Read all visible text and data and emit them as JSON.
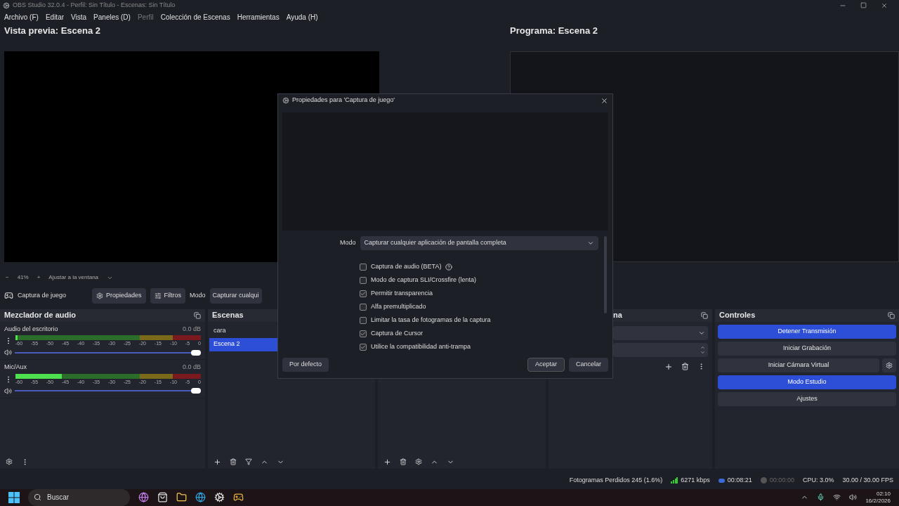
{
  "window": {
    "title": "OBS Studio 32.0.4 - Perfil: Sin Título - Escenas: Sin Título"
  },
  "menu": [
    {
      "label": "Archivo (F)",
      "disabled": false
    },
    {
      "label": "Editar",
      "disabled": false
    },
    {
      "label": "Vista",
      "disabled": false
    },
    {
      "label": "Paneles (D)",
      "disabled": false
    },
    {
      "label": "Perfil",
      "disabled": true
    },
    {
      "label": "Colección de Escenas",
      "disabled": false
    },
    {
      "label": "Herramientas",
      "disabled": false
    },
    {
      "label": "Ayuda (H)",
      "disabled": false
    }
  ],
  "preview": {
    "title": "Vista previa: Escena 2",
    "minus": "−",
    "zoom": "41%",
    "plus": "+",
    "fit": "Ajustar a la ventana"
  },
  "program": {
    "title": "Programa: Escena 2"
  },
  "source_bar": {
    "source": "Captura de juego",
    "properties": "Propiedades",
    "filters": "Filtros",
    "mode_label": "Modo",
    "mode_value": "Capturar cualqui"
  },
  "mixer": {
    "title": "Mezclador de audio",
    "channels": [
      {
        "name": "Audio del escritorio",
        "reading": "0.0 dB",
        "level": 0.01,
        "scale": [
          "-60",
          "-55",
          "-50",
          "-45",
          "-40",
          "-35",
          "-30",
          "-25",
          "-20",
          "-15",
          "-10",
          "-5",
          "0"
        ],
        "volume": {
          "level": 1
        }
      },
      {
        "name": "Mic/Aux",
        "reading": "0.0 dB",
        "level": 0.25,
        "scale": [
          "-60",
          "-55",
          "-50",
          "-45",
          "-40",
          "-35",
          "-30",
          "-25",
          "-20",
          "-15",
          "-10",
          "-5",
          "0"
        ],
        "volume": {
          "level": 1
        }
      }
    ]
  },
  "scenes": {
    "title": "Escenas",
    "items": [
      {
        "name": "cara",
        "selected": false
      },
      {
        "name": "Escena 2",
        "selected": true
      }
    ]
  },
  "transitions": {
    "title": "na"
  },
  "controls": {
    "title": "Controles",
    "buttons": [
      {
        "label": "Detener Transmisión",
        "active": true,
        "kind": "plain"
      },
      {
        "label": "Iniciar Grabación",
        "active": false,
        "kind": "plain"
      },
      {
        "label": "Iniciar Cámara Virtual",
        "active": false,
        "kind": "settings"
      },
      {
        "label": "Modo Estudio",
        "active": true,
        "kind": "plain"
      },
      {
        "label": "Ajustes",
        "active": false,
        "kind": "plain"
      }
    ]
  },
  "dialog": {
    "title": "Propiedades para 'Captura de juego'",
    "mode_label": "Modo",
    "mode_value": "Capturar cualquier aplicación de pantalla completa",
    "options": [
      {
        "label": "Captura de audio (BETA)",
        "checked": false,
        "help": true
      },
      {
        "label": "Modo de captura SLI/Crossfire (lenta)",
        "checked": false,
        "help": false
      },
      {
        "label": "Permitir transparencia",
        "checked": true,
        "help": false
      },
      {
        "label": "Alfa premultiplicado",
        "checked": false,
        "help": false
      },
      {
        "label": "Limitar la tasa de fotogramas de la captura",
        "checked": false,
        "help": false
      },
      {
        "label": "Captura de Cursor",
        "checked": true,
        "help": false
      },
      {
        "label": "Utilice la compatibilidad anti-trampa",
        "checked": true,
        "help": false
      }
    ],
    "defaults": "Por defecto",
    "ok": "Aceptar",
    "cancel": "Cancelar"
  },
  "status": {
    "dropped": "Fotogramas Perdidos 245 (1.6%)",
    "bitrate": "6271 kbps",
    "stream_time": "00:08:21",
    "streaming": true,
    "record_time": "00:00:00",
    "recording": false,
    "cpu": "CPU: 3.0%",
    "fps": "30.00 / 30.00 FPS"
  },
  "taskbar": {
    "search": "Buscar",
    "time": "02:10",
    "date": "16/2/2026"
  }
}
